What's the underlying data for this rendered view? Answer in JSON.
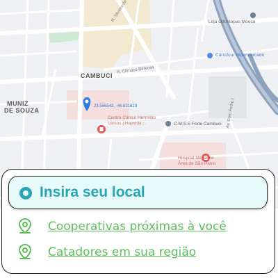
{
  "map": {
    "district_labels": {
      "cambuci": "CAMBUCI",
      "muniz_line1": "MUNIZ",
      "muniz_line2": "DE SOUZA"
    },
    "street_labels": {
      "r_tamandare": "R. Tamandaré",
      "r_silveira_da_motta": "R. Silveira da Motta",
      "r_clemente_barbosa": "R. Clímaco Barbosa",
      "av_dom_pedro": "Av. Dom Pedro I",
      "r_lavapes": "R. Lavapés"
    },
    "pois": {
      "loja_odontopas": "Loja Odontopas Mooca",
      "carrefour": "Carrefour Hipermercado",
      "coordinates": "23.566543, -46.621620",
      "centro_clinico_line1": "Centro Clínico Herminio",
      "centro_clinico_line2": "Lemos | Hapvida...",
      "cmse_forte": "C.M.S.E Forte Cambuci",
      "hospital_line1": "Hospital Militar de",
      "hospital_line2": "Área de São Paulo"
    }
  },
  "panel": {
    "search_label": "Insira seu local",
    "links": [
      {
        "label": "Cooperativas próximas à você",
        "icon": "map-pin-icon"
      },
      {
        "label": "Catadores em sua região",
        "icon": "map-pin-icon"
      }
    ]
  },
  "colors": {
    "accent_teal": "#2aa3b3",
    "link_green": "#5cbf5c",
    "search_bg": "#e6fafa"
  }
}
